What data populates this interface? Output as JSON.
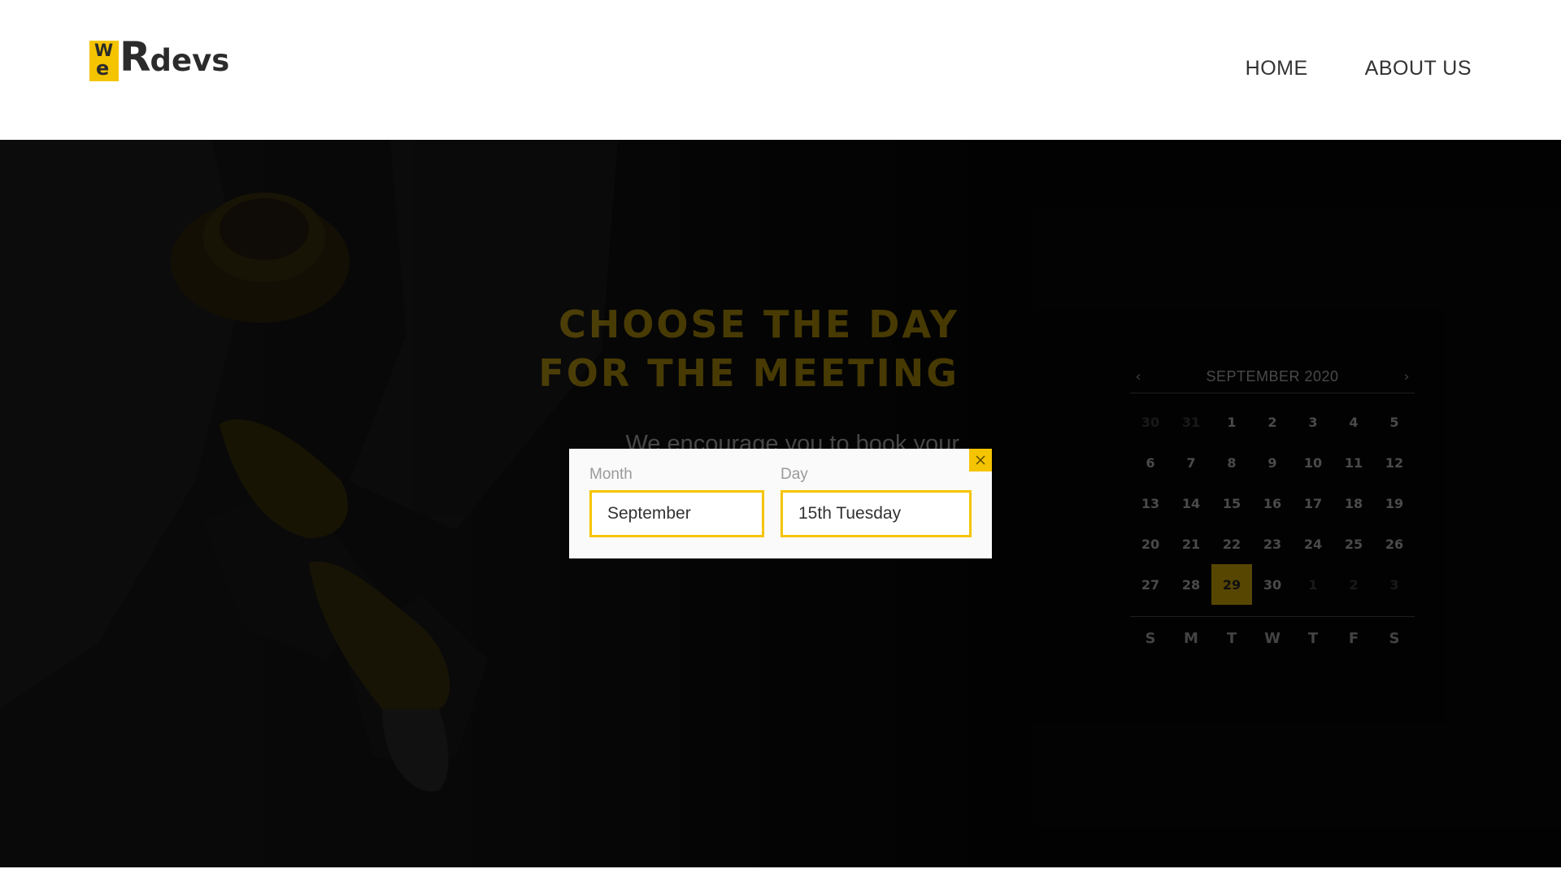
{
  "brand": {
    "logo_w": "W",
    "logo_e": "e",
    "logo_r": "R",
    "logo_devs": "devs"
  },
  "nav": {
    "items": [
      "HOME",
      "ABOUT US"
    ]
  },
  "hero": {
    "title_line1": "CHOOSE THE DAY",
    "title_line2": "FOR THE MEETING",
    "subtitle": "We encourage you to book your"
  },
  "calendar": {
    "title": "SEPTEMBER 2020",
    "prev_icon": "chevron-left-icon",
    "next_icon": "chevron-right-icon",
    "days": [
      "30",
      "31",
      "1",
      "2",
      "3",
      "4",
      "5",
      "6",
      "7",
      "8",
      "9",
      "10",
      "11",
      "12",
      "13",
      "14",
      "15",
      "16",
      "17",
      "18",
      "19",
      "20",
      "21",
      "22",
      "23",
      "24",
      "25",
      "26",
      "27",
      "28",
      "29",
      "30",
      "1",
      "2",
      "3"
    ],
    "selected": "29",
    "weekdays": [
      "S",
      "M",
      "T",
      "W",
      "T",
      "F",
      "S"
    ]
  },
  "modal": {
    "month_label": "Month",
    "month_value": "September",
    "day_label": "Day",
    "day_value": "15th Tuesday",
    "close_icon": "close-icon"
  },
  "colors": {
    "accent": "#f5c400",
    "dark": "#060606",
    "text": "#333333"
  }
}
